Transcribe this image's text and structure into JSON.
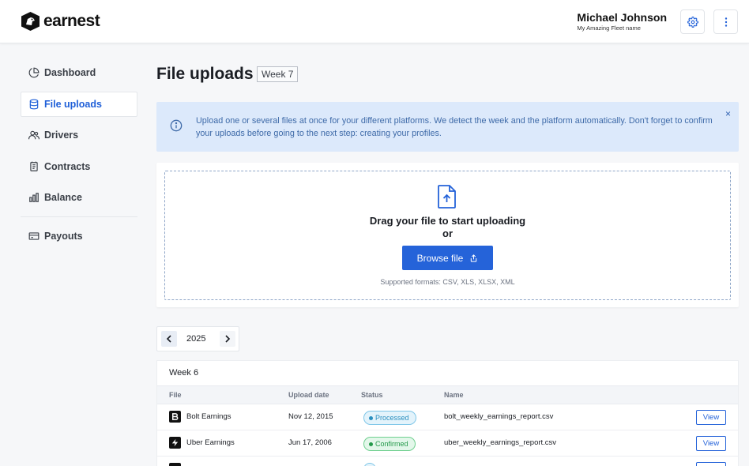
{
  "brand": {
    "name": "earnest"
  },
  "user": {
    "name": "Michael Johnson",
    "fleet": "My Amazing Fleet name"
  },
  "sidebar": {
    "items": [
      {
        "label": "Dashboard",
        "icon": "pie-chart-icon"
      },
      {
        "label": "File uploads",
        "icon": "database-icon",
        "active": true
      },
      {
        "label": "Drivers",
        "icon": "users-icon"
      },
      {
        "label": "Contracts",
        "icon": "document-icon"
      },
      {
        "label": "Balance",
        "icon": "bar-chart-icon"
      }
    ],
    "secondary": [
      {
        "label": "Payouts",
        "icon": "credit-card-icon"
      }
    ]
  },
  "page": {
    "title": "File uploads",
    "week_badge": "Week 7"
  },
  "info": {
    "text": "Upload one or several files at once for your different platforms. We detect the week and the platform automatically. Don't forget to confirm your uploads before going to the next step: creating your profiles.",
    "close": "×"
  },
  "upload": {
    "drag_text": "Drag your file to start uploading",
    "or_text": "or",
    "browse_label": "Browse file",
    "formats": "Supported formats: CSV, XLS, XLSX, XML"
  },
  "year_nav": {
    "year": "2025"
  },
  "table": {
    "week_title": "Week 6",
    "columns": {
      "file": "File",
      "upload_date": "Upload date",
      "status": "Status",
      "name": "Name"
    },
    "rows": [
      {
        "file": "Bolt Earnings",
        "upload_date": "Nov 12, 2015",
        "status": "Processed",
        "name": "bolt_weekly_earnings_report.csv",
        "action": "View"
      },
      {
        "file": "Uber Earnings",
        "upload_date": "Jun 17, 2006",
        "status": "Confirmed",
        "name": "uber_weekly_earnings_report.csv",
        "action": "View"
      }
    ]
  },
  "colors": {
    "accent": "#2563d9",
    "info_bg": "#dce9fb",
    "processed": "#2a8fbf",
    "confirmed": "#24994a"
  }
}
